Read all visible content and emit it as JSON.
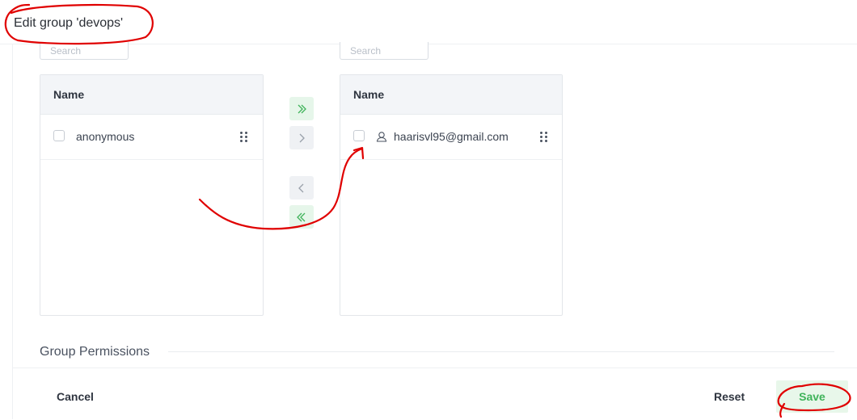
{
  "dialog": {
    "title": "Edit group 'devops'"
  },
  "available": {
    "search_placeholder": "Search",
    "header": "Name",
    "items": [
      {
        "label": "anonymous"
      }
    ]
  },
  "selected": {
    "search_placeholder": "Search",
    "header": "Name",
    "items": [
      {
        "label": "haarisvl95@gmail.com",
        "icon": "user-icon"
      }
    ]
  },
  "transfer": {
    "move_all_right_icon": "double-chevron-right-icon",
    "move_right_icon": "chevron-right-icon",
    "move_left_icon": "chevron-left-icon",
    "move_all_left_icon": "double-chevron-left-icon"
  },
  "permissions": {
    "section_label": "Group Permissions"
  },
  "footer": {
    "cancel_label": "Cancel",
    "reset_label": "Reset",
    "save_label": "Save"
  },
  "colors": {
    "accent_green": "#3fb35a",
    "annotation_red": "#e00000"
  }
}
